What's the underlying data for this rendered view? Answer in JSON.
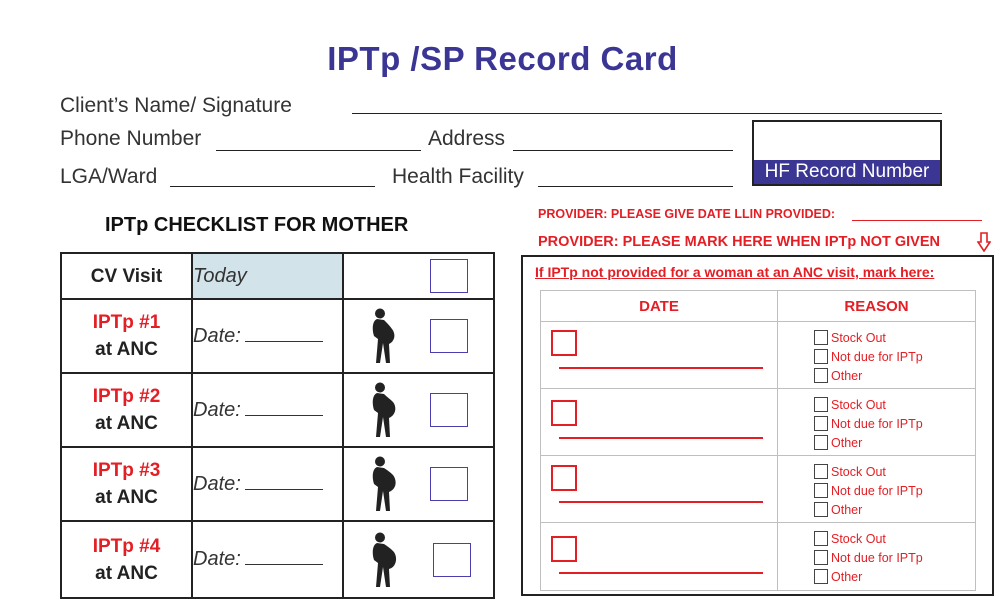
{
  "title": "IPTp /SP Record Card",
  "fields": {
    "client_name": "Client’s Name/ Signature",
    "phone": "Phone Number",
    "address": "Address",
    "lga": "LGA/Ward",
    "facility": "Health Facility",
    "hf_record": "HF Record Number"
  },
  "checklist": {
    "title": "IPTp CHECKLIST FOR MOTHER",
    "cv_visit": "CV Visit",
    "today": "Today",
    "date_label": "Date:",
    "rows": [
      {
        "dose": "IPTp #1",
        "place": "at ANC"
      },
      {
        "dose": "IPTp #2",
        "place": "at ANC"
      },
      {
        "dose": "IPTp #3",
        "place": "at ANC"
      },
      {
        "dose": "IPTp #4",
        "place": "at ANC"
      }
    ]
  },
  "provider": {
    "llin": "PROVIDER: PLEASE GIVE DATE LLIN PROVIDED:",
    "mark": "PROVIDER: PLEASE MARK HERE WHEN IPTp NOT GIVEN",
    "box_title": "If IPTp not provided for a woman at an ANC visit, mark here:",
    "date_header": "DATE",
    "reason_header": "REASON",
    "reasons": [
      "Stock Out",
      "Not due for IPTp",
      "Other"
    ]
  },
  "colors": {
    "brand": "#3b3694",
    "accent_red": "#e31e24",
    "today_bg": "#d3e3ea"
  }
}
